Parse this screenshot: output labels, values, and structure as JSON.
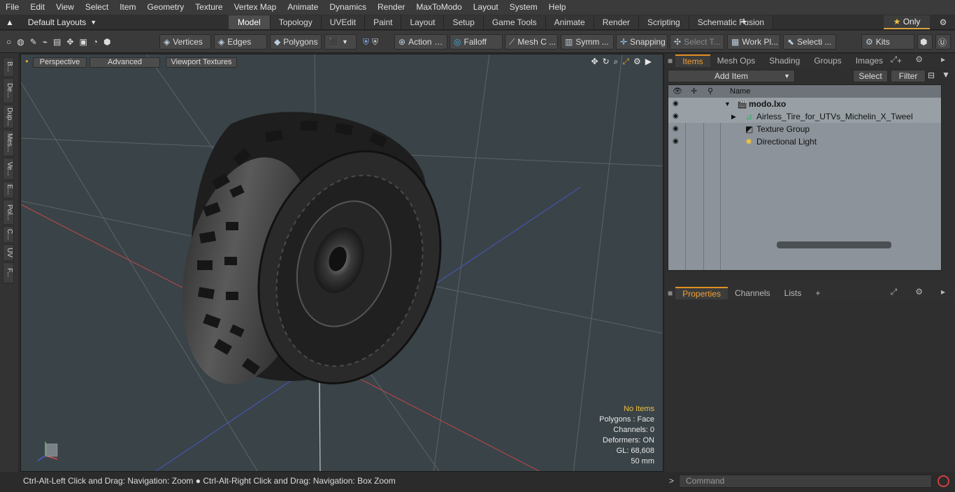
{
  "menu": [
    "File",
    "Edit",
    "View",
    "Select",
    "Item",
    "Geometry",
    "Texture",
    "Vertex Map",
    "Animate",
    "Dynamics",
    "Render",
    "MaxToModo",
    "Layout",
    "System",
    "Help"
  ],
  "layout_selector": "Default Layouts",
  "tabs": [
    "Model",
    "Topology",
    "UVEdit",
    "Paint",
    "Layout",
    "Setup",
    "Game Tools",
    "Animate",
    "Render",
    "Scripting",
    "Schematic Fusion"
  ],
  "active_tab": "Model",
  "only_label": "Only",
  "toolbar": {
    "vertices": "Vertices",
    "edges": "Edges",
    "polygons": "Polygons",
    "action": "Action",
    "falloff": "Falloff",
    "mesh": "Mesh C ...",
    "symm": "Symm ...",
    "snapping": "Snapping",
    "select_t": "Select T...",
    "work_pl": "Work Pl...",
    "selecti": "Selecti ...",
    "kits": "Kits"
  },
  "left_strip": [
    "B...",
    "De...",
    "Dup...",
    "Mes...",
    "Ve...",
    "E...",
    "Pol...",
    "C...",
    "UV",
    "F..."
  ],
  "viewport": {
    "perspective": "Perspective",
    "advanced": "Advanced",
    "textures": "Viewport Textures",
    "info": {
      "no_items": "No Items",
      "polygons": "Polygons : Face",
      "channels": "Channels: 0",
      "deformers": "Deformers: ON",
      "gl": "GL: 68,608",
      "size": "50 mm"
    }
  },
  "status": "Ctrl-Alt-Left Click and Drag: Navigation: Zoom ● Ctrl-Alt-Right Click and Drag: Navigation: Box Zoom",
  "items_panel": {
    "tabs": [
      "Items",
      "Mesh Ops",
      "Shading",
      "Groups",
      "Images"
    ],
    "add_item": "Add Item",
    "select": "Select",
    "filter": "Filter",
    "col_name": "Name",
    "rows": [
      "modo.lxo",
      "Airless_Tire_for_UTVs_Michelin_X_Tweel",
      "Texture Group",
      "Directional Light"
    ]
  },
  "props_panel": {
    "tabs": [
      "Properties",
      "Channels",
      "Lists"
    ]
  },
  "command_placeholder": "Command"
}
